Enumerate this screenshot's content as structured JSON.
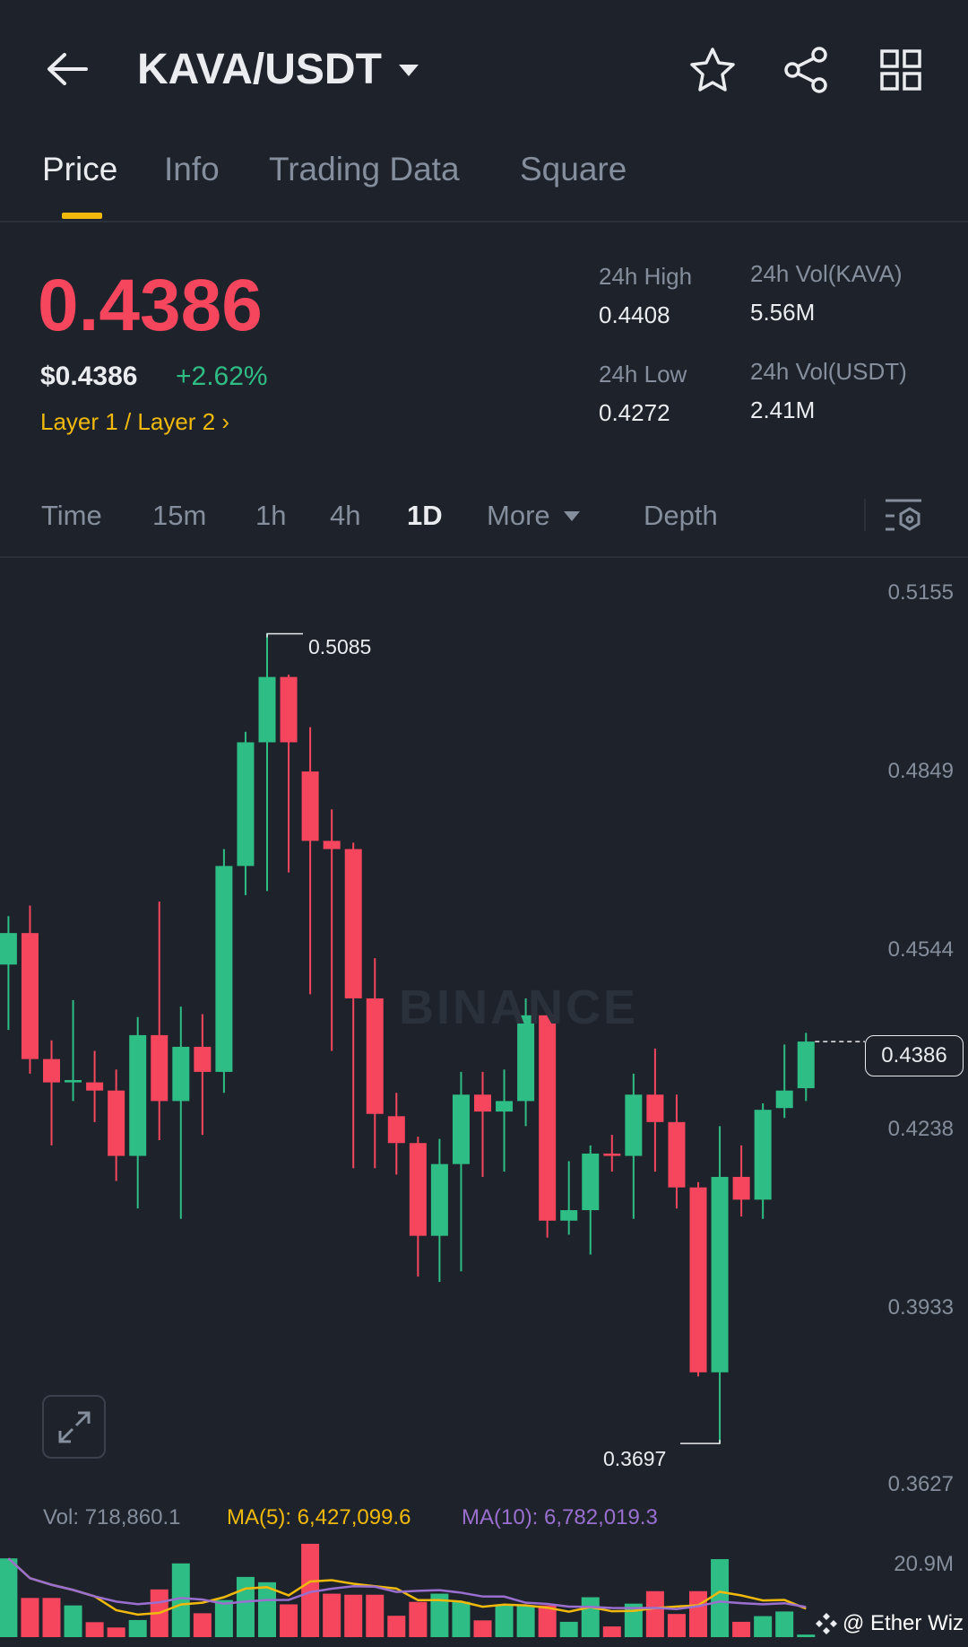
{
  "header": {
    "title": "KAVA/USDT",
    "icons": [
      "back-arrow-icon",
      "caret-down-icon",
      "star-icon",
      "share-icon",
      "grid-icon"
    ]
  },
  "tabs": [
    {
      "label": "Price"
    },
    {
      "label": "Info"
    },
    {
      "label": "Trading Data"
    },
    {
      "label": "Square"
    }
  ],
  "ticker": {
    "price": "0.4386",
    "usd_price": "$0.4386",
    "change": "+2.62%",
    "tag": "Layer 1 / Layer 2",
    "high_label": "24h High",
    "high": "0.4408",
    "low_label": "24h Low",
    "low": "0.4272",
    "vol_base_label": "24h Vol(KAVA)",
    "vol_base": "5.56M",
    "vol_quote_label": "24h Vol(USDT)",
    "vol_quote": "2.41M"
  },
  "timeframes": [
    {
      "label": "Time"
    },
    {
      "label": "15m"
    },
    {
      "label": "1h"
    },
    {
      "label": "4h"
    },
    {
      "label": "1D"
    },
    {
      "label": "More"
    },
    {
      "label": "Depth"
    }
  ],
  "colors": {
    "up": "#2ebd85",
    "down": "#f6465d",
    "accent": "#f0b90b",
    "ma5": "#f0b90b",
    "ma10": "#9a6fd0"
  },
  "watermark": "BINANCE",
  "credit": "@ Ether Wiz",
  "volume_info": {
    "vol": "Vol: 718,860.1",
    "ma5": "MA(5): 6,427,099.6",
    "ma10": "MA(10): 6,782,019.3",
    "axis_max": "20.9M"
  },
  "chart_data": {
    "type": "candlestick",
    "interval": "1D",
    "price_axis": [
      "0.5155",
      "0.4849",
      "0.4544",
      "0.4238",
      "0.3933",
      "0.3627"
    ],
    "ylim": [
      0.3627,
      0.5155
    ],
    "high_marker": "0.5085",
    "low_marker": "0.3697",
    "last_price": "0.4386",
    "candles": [
      [
        0.4518,
        0.4601,
        0.4406,
        0.4572
      ],
      [
        0.4572,
        0.4619,
        0.4331,
        0.4356
      ],
      [
        0.4356,
        0.4388,
        0.4208,
        0.4316
      ],
      [
        0.4316,
        0.4457,
        0.4284,
        0.432
      ],
      [
        0.4316,
        0.437,
        0.4248,
        0.4302
      ],
      [
        0.4302,
        0.4338,
        0.4147,
        0.419
      ],
      [
        0.419,
        0.4428,
        0.41,
        0.4397
      ],
      [
        0.4397,
        0.4626,
        0.4217,
        0.4284
      ],
      [
        0.4284,
        0.4446,
        0.4082,
        0.4377
      ],
      [
        0.4377,
        0.4433,
        0.4226,
        0.4334
      ],
      [
        0.4334,
        0.4716,
        0.4298,
        0.4687
      ],
      [
        0.4687,
        0.4917,
        0.4637,
        0.4899
      ],
      [
        0.4899,
        0.5085,
        0.4644,
        0.5011
      ],
      [
        0.5011,
        0.5015,
        0.4676,
        0.4899
      ],
      [
        0.4849,
        0.4925,
        0.4467,
        0.473
      ],
      [
        0.473,
        0.4784,
        0.437,
        0.4716
      ],
      [
        0.4716,
        0.4727,
        0.4169,
        0.446
      ],
      [
        0.446,
        0.4529,
        0.4169,
        0.4262
      ],
      [
        0.4258,
        0.4298,
        0.4158,
        0.4212
      ],
      [
        0.4212,
        0.4223,
        0.3983,
        0.4053
      ],
      [
        0.4053,
        0.4219,
        0.3974,
        0.4176
      ],
      [
        0.4176,
        0.4334,
        0.3992,
        0.4295
      ],
      [
        0.4295,
        0.4334,
        0.4154,
        0.4266
      ],
      [
        0.4266,
        0.4338,
        0.4163,
        0.4284
      ],
      [
        0.4284,
        0.446,
        0.4241,
        0.4431
      ],
      [
        0.4431,
        0.4439,
        0.405,
        0.4079
      ],
      [
        0.4079,
        0.4181,
        0.4055,
        0.4097
      ],
      [
        0.4097,
        0.4208,
        0.4021,
        0.4194
      ],
      [
        0.4194,
        0.4226,
        0.4163,
        0.419
      ],
      [
        0.419,
        0.4331,
        0.4082,
        0.4295
      ],
      [
        0.4295,
        0.4374,
        0.4163,
        0.4248
      ],
      [
        0.4248,
        0.4295,
        0.41,
        0.4136
      ],
      [
        0.4136,
        0.4145,
        0.3812,
        0.3819
      ],
      [
        0.3819,
        0.4241,
        0.3697,
        0.4154
      ],
      [
        0.4154,
        0.4208,
        0.4086,
        0.4115
      ],
      [
        0.4115,
        0.428,
        0.4082,
        0.4269
      ],
      [
        0.4272,
        0.4381,
        0.4255,
        0.4302
      ],
      [
        0.4306,
        0.4401,
        0.4284,
        0.4386
      ]
    ],
    "volumes_m": [
      22.1,
      11.0,
      11.0,
      8.9,
      4.2,
      2.7,
      4.8,
      13.4,
      20.7,
      6.7,
      10.4,
      16.9,
      15.4,
      9.2,
      26.2,
      12.2,
      11.9,
      11.9,
      6.0,
      9.9,
      12.2,
      9.9,
      4.7,
      8.9,
      8.9,
      8.9,
      4.3,
      11.2,
      3.0,
      9.4,
      12.9,
      6.5,
      12.9,
      21.9,
      4.3,
      5.9,
      7.2,
      0.72
    ],
    "volume_axis_max_m": 20.9
  }
}
